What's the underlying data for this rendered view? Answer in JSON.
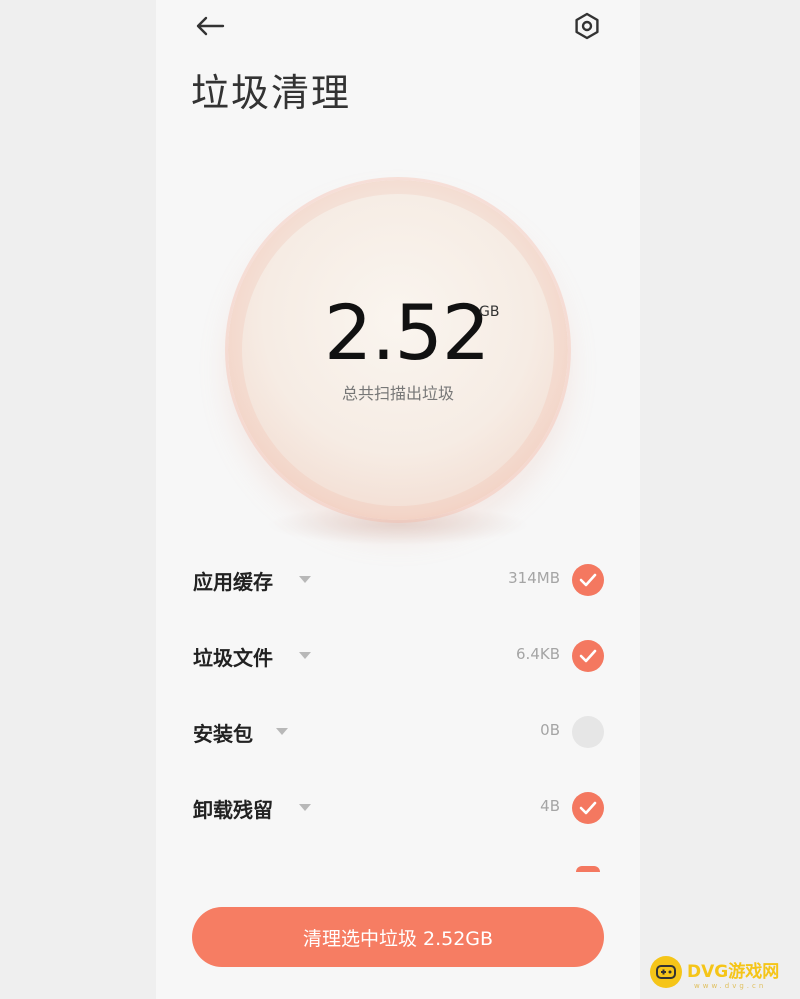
{
  "header": {
    "back_icon": "arrow-left-icon",
    "settings_icon": "settings-hexagon-icon",
    "title": "垃圾清理"
  },
  "scan": {
    "total_value": "2.52",
    "total_unit": "GB",
    "caption": "总共扫描出垃圾"
  },
  "categories": [
    {
      "label": "应用缓存",
      "size": "314MB",
      "checked": true
    },
    {
      "label": "垃圾文件",
      "size": "6.4KB",
      "checked": true
    },
    {
      "label": "安装包",
      "size": "0B",
      "checked": false
    },
    {
      "label": "卸载残留",
      "size": "4B",
      "checked": true
    }
  ],
  "action": {
    "clean_label": "清理选中垃圾 2.52GB"
  },
  "watermark": {
    "text": "DVG游戏网",
    "sub": "www.dvg.cn"
  },
  "colors": {
    "accent": "#f67d63",
    "check_on": "#f47860",
    "check_off": "#e6e6e6",
    "watermark": "#f5c518"
  }
}
